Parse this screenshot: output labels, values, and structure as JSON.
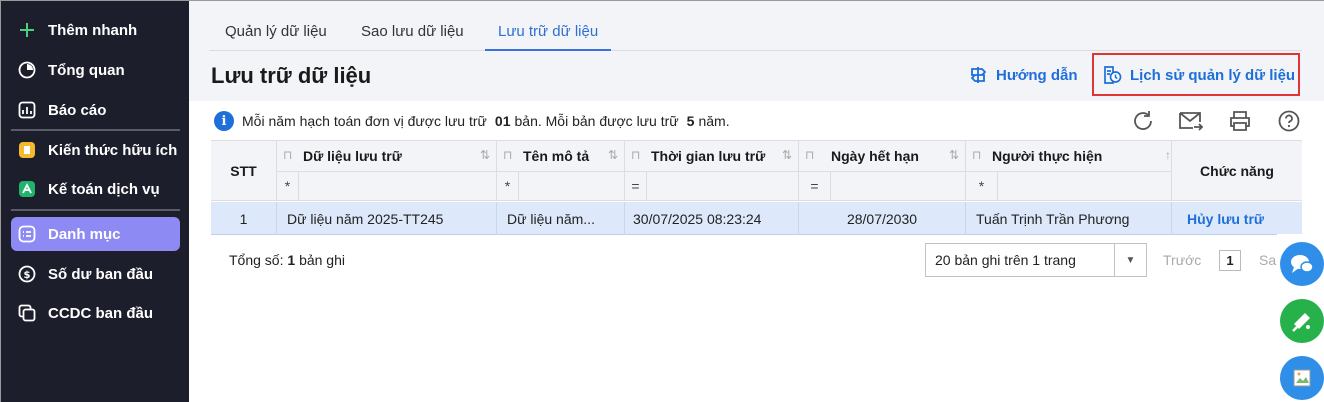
{
  "sidebar": {
    "quick_add": "Thêm nhanh",
    "items": [
      {
        "label": "Tổng quan",
        "icon": "dashboard-icon"
      },
      {
        "label": "Báo cáo",
        "icon": "report-icon"
      },
      {
        "label": "Kiến thức hữu ích",
        "icon": "knowledge-icon"
      },
      {
        "label": "Kế toán dịch vụ",
        "icon": "service-accounting-icon"
      },
      {
        "label": "Danh mục",
        "icon": "catalog-icon"
      },
      {
        "label": "Số dư ban đầu",
        "icon": "opening-balance-icon"
      },
      {
        "label": "CCDC ban đầu",
        "icon": "initial-tools-icon"
      }
    ]
  },
  "tabs": [
    {
      "label": "Quản lý dữ liệu"
    },
    {
      "label": "Sao lưu dữ liệu"
    },
    {
      "label": "Lưu trữ dữ liệu"
    }
  ],
  "header": {
    "title": "Lưu trữ dữ liệu",
    "guide": "Hướng dẫn",
    "history": "Lịch sử quản lý dữ liệu"
  },
  "info": {
    "prefix": "Mỗi năm hạch toán đơn vị được lưu trữ",
    "count": "01",
    "middle": "bản. Mỗi bản được lưu trữ",
    "years": "5",
    "suffix": "năm."
  },
  "table": {
    "columns": [
      {
        "label": "STT",
        "filter": ""
      },
      {
        "label": "Dữ liệu lưu trữ",
        "filter": "*"
      },
      {
        "label": "Tên mô tả",
        "filter": "*"
      },
      {
        "label": "Thời gian lưu trữ",
        "filter": "="
      },
      {
        "label": "Ngày hết hạn",
        "filter": "="
      },
      {
        "label": "Người thực hiện",
        "filter": "*"
      },
      {
        "label": "Chức năng",
        "filter": ""
      }
    ],
    "rows": [
      {
        "stt": "1",
        "data": "Dữ liệu năm 2025-TT245",
        "desc": "Dữ liệu năm...",
        "time": "30/07/2025 08:23:24",
        "expiry": "28/07/2030",
        "user": "Tuấn Trịnh Trần Phương",
        "action": "Hủy lưu trữ"
      }
    ]
  },
  "footer": {
    "total_label": "Tổng số:",
    "total_count": "1",
    "total_unit": "bản ghi",
    "page_size": "20 bản ghi trên 1 trang",
    "prev": "Trước",
    "page": "1",
    "next": "Sau"
  },
  "colors": {
    "sidebar_bg": "#1c1e2b",
    "active_item": "#8e8af3",
    "accent": "#1e6fd9",
    "highlight_box": "#e03535",
    "selected_row": "#dde9fb"
  }
}
